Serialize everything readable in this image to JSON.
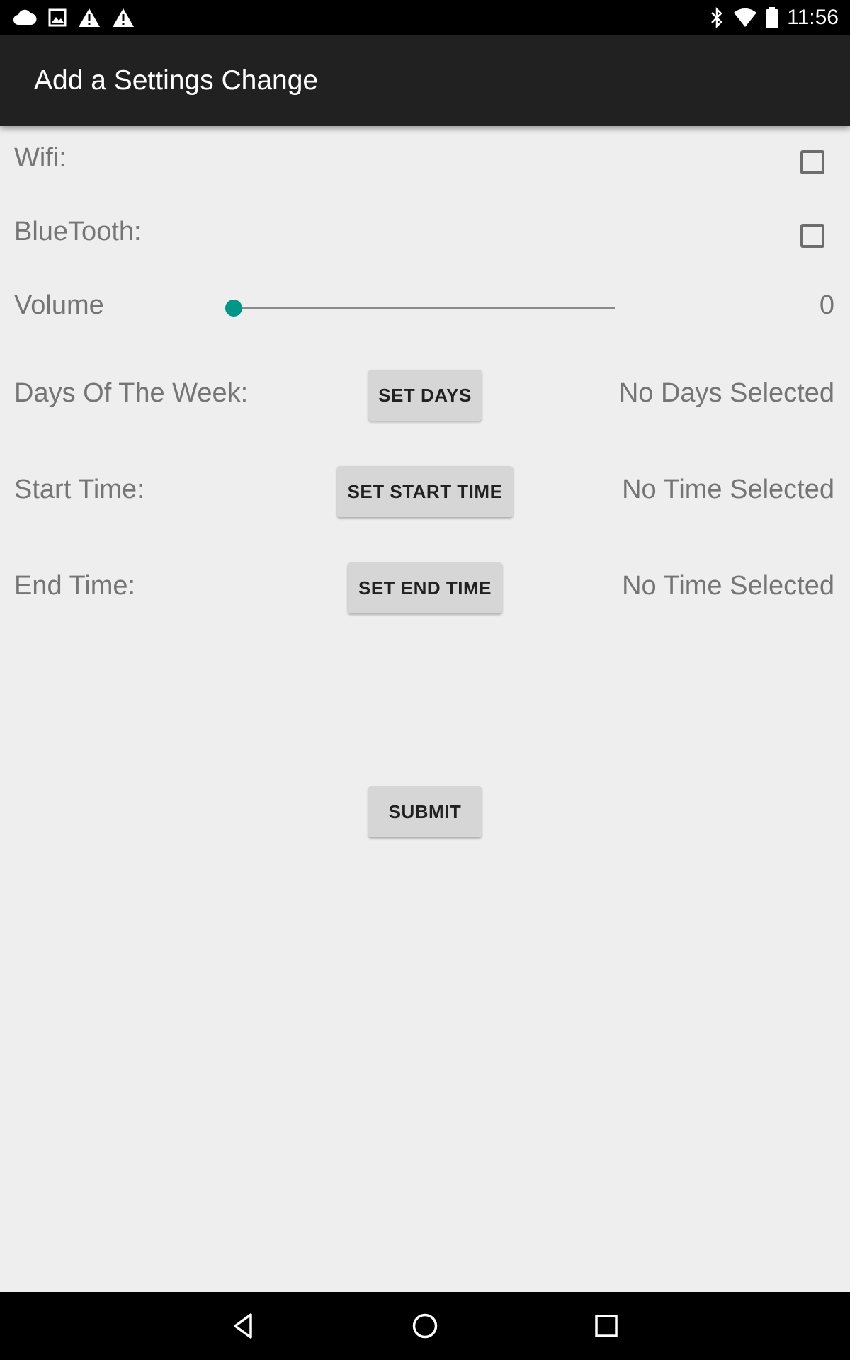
{
  "status_bar": {
    "time": "11:56",
    "left_icons": [
      "cloud-icon",
      "image-icon",
      "warning-icon",
      "warning-icon"
    ],
    "right_icons": [
      "bluetooth-icon",
      "wifi-icon",
      "battery-icon"
    ]
  },
  "app_bar": {
    "title": "Add a Settings Change"
  },
  "form": {
    "wifi": {
      "label": "Wifi:",
      "checked": false
    },
    "bluetooth": {
      "label": "BlueTooth:",
      "checked": false
    },
    "volume": {
      "label": "Volume",
      "value": "0",
      "level": 0,
      "accent": "#009688"
    },
    "days": {
      "label": "Days Of The Week:",
      "button": "SET DAYS",
      "status": "No Days Selected"
    },
    "start_time": {
      "label": "Start Time:",
      "button": "SET START TIME",
      "status": "No Time Selected"
    },
    "end_time": {
      "label": "End Time:",
      "button": "SET END TIME",
      "status": "No Time Selected"
    },
    "submit": "SUBMIT"
  },
  "nav_bar": {
    "icons": [
      "back-icon",
      "home-icon",
      "recents-icon"
    ]
  }
}
